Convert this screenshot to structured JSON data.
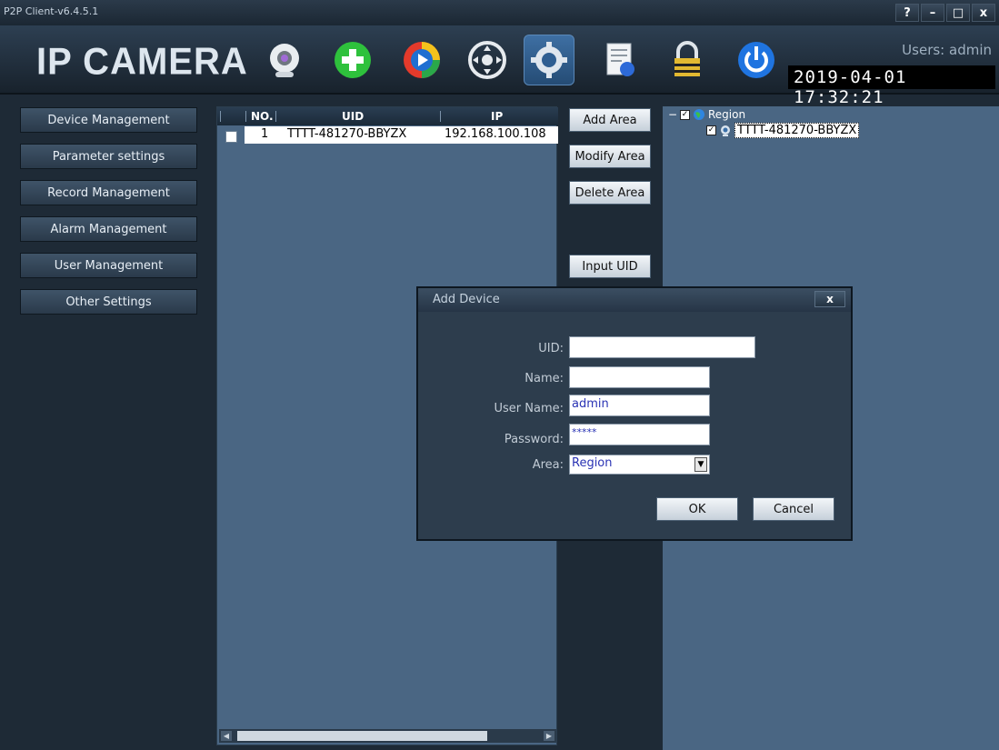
{
  "window": {
    "title": "P2P Client-v6.4.5.1",
    "controls": {
      "help": "?",
      "minimize": "–",
      "maximize": "□",
      "close": "x"
    }
  },
  "header": {
    "logo": "IP CAMERA",
    "users": "Users: admin",
    "clock": "2019-04-01  17:32:21",
    "tools": [
      "camera-icon",
      "add-device-icon",
      "playback-icon",
      "ptz-icon",
      "settings-gear-icon",
      "log-report-icon",
      "lock-icon",
      "power-icon"
    ]
  },
  "leftnav": {
    "items": [
      {
        "label": "Device Management"
      },
      {
        "label": "Parameter settings"
      },
      {
        "label": "Record Management"
      },
      {
        "label": "Alarm Management"
      },
      {
        "label": "User Management"
      },
      {
        "label": "Other Settings"
      }
    ]
  },
  "device_table": {
    "columns": [
      "NO.",
      "UID",
      "IP"
    ],
    "rows": [
      {
        "no": "1",
        "uid": "TTTT-481270-BBYZX",
        "ip": "192.168.100.108"
      }
    ]
  },
  "area_buttons": {
    "add": "Add Area",
    "modify": "Modify Area",
    "delete": "Delete Area",
    "input_uid": "Input UID"
  },
  "tree": {
    "collapse": "−",
    "root": "Region",
    "child": "TTTT-481270-BBYZX"
  },
  "dialog": {
    "title": "Add Device",
    "close": "x",
    "uid_label": "UID:",
    "uid_value": "",
    "name_label": "Name:",
    "name_value": "",
    "username_label": "User Name:",
    "username_value": "admin",
    "password_label": "Password:",
    "password_value": "*****",
    "area_label": "Area:",
    "area_value": "Region",
    "ok": "OK",
    "cancel": "Cancel"
  }
}
